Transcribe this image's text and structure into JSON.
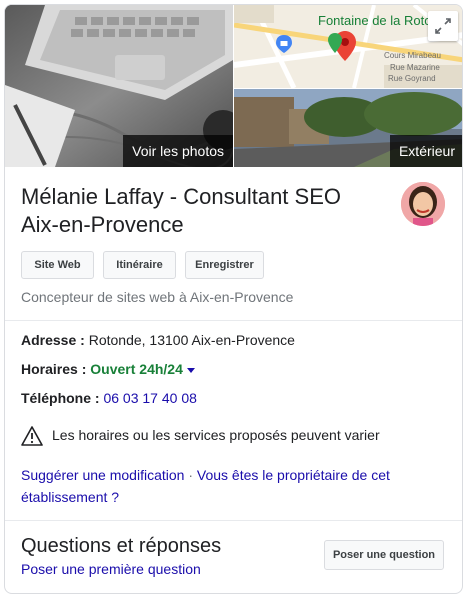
{
  "photos": {
    "main_label": "Voir les photos",
    "street_label": "Extérieur",
    "map": {
      "title": "Fontaine de la Rotonde",
      "street_1": "Cours Mirabeau",
      "street_2": "Rue Mazarine",
      "street_3": "Rue Goyrand",
      "expand_icon": "expand-icon"
    }
  },
  "business": {
    "name": "Mélanie Laffay - Consultant SEO Aix-en-Provence",
    "category": "Concepteur de sites web à Aix-en-Provence"
  },
  "actions": {
    "website": "Site Web",
    "directions": "Itinéraire",
    "save": "Enregistrer"
  },
  "details": {
    "address_label": "Adresse",
    "address_value": "Rotonde, 13100 Aix-en-Provence",
    "hours_label": "Horaires",
    "hours_value": "Ouvert 24h/24",
    "phone_label": "Téléphone",
    "phone_value": "06 03 17 40 08",
    "separator": " : "
  },
  "warning": {
    "icon": "warning-icon",
    "text": "Les horaires ou les services proposés peuvent varier"
  },
  "links": {
    "suggest": "Suggérer une modification",
    "dot": " · ",
    "owner": "Vous êtes le propriétaire de cet établissement ?"
  },
  "qa": {
    "title": "Questions et réponses",
    "first_question_link": "Poser une première question",
    "ask_button": "Poser une question"
  },
  "colors": {
    "link": "#1a0dab",
    "open": "#188038",
    "muted": "#70757a",
    "border": "#dadce0"
  }
}
